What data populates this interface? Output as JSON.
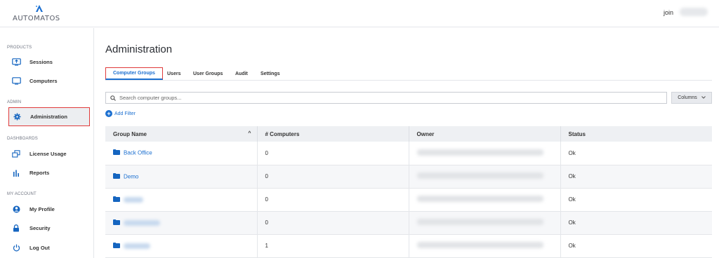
{
  "header": {
    "logo_text": "AUTOMATOS",
    "user_name": "join"
  },
  "sidebar": {
    "sections": [
      {
        "label": "PRODUCTS",
        "items": [
          {
            "label": "Sessions",
            "icon": "screen-arrow-icon"
          },
          {
            "label": "Computers",
            "icon": "monitor-icon"
          }
        ]
      },
      {
        "label": "ADMIN",
        "items": [
          {
            "label": "Administration",
            "icon": "gear-icon",
            "active": true
          }
        ]
      },
      {
        "label": "DASHBOARDS",
        "items": [
          {
            "label": "License Usage",
            "icon": "license-icon"
          },
          {
            "label": "Reports",
            "icon": "bar-chart-icon"
          }
        ]
      },
      {
        "label": "MY ACCOUNT",
        "items": [
          {
            "label": "My Profile",
            "icon": "user-circle-icon"
          },
          {
            "label": "Security",
            "icon": "lock-icon"
          },
          {
            "label": "Log Out",
            "icon": "power-icon"
          }
        ]
      }
    ]
  },
  "main": {
    "title": "Administration",
    "tabs": [
      "Computer Groups",
      "Users",
      "User Groups",
      "Audit",
      "Settings"
    ],
    "search_placeholder": "Search computer groups...",
    "columns_label": "Columns",
    "add_filter_label": "Add Filter",
    "table": {
      "headers": [
        "Group Name",
        "# Computers",
        "Owner",
        "Status"
      ],
      "rows": [
        {
          "name": "Back Office",
          "computers": "0",
          "status": "Ok"
        },
        {
          "name": "Demo",
          "computers": "0",
          "status": "Ok"
        },
        {
          "name": "",
          "computers": "0",
          "status": "Ok"
        },
        {
          "name": "",
          "computers": "0",
          "status": "Ok"
        },
        {
          "name": "",
          "computers": "1",
          "status": "Ok"
        }
      ]
    }
  },
  "colors": {
    "accent": "#1b6fd0",
    "highlight_border": "#e03a3a"
  }
}
